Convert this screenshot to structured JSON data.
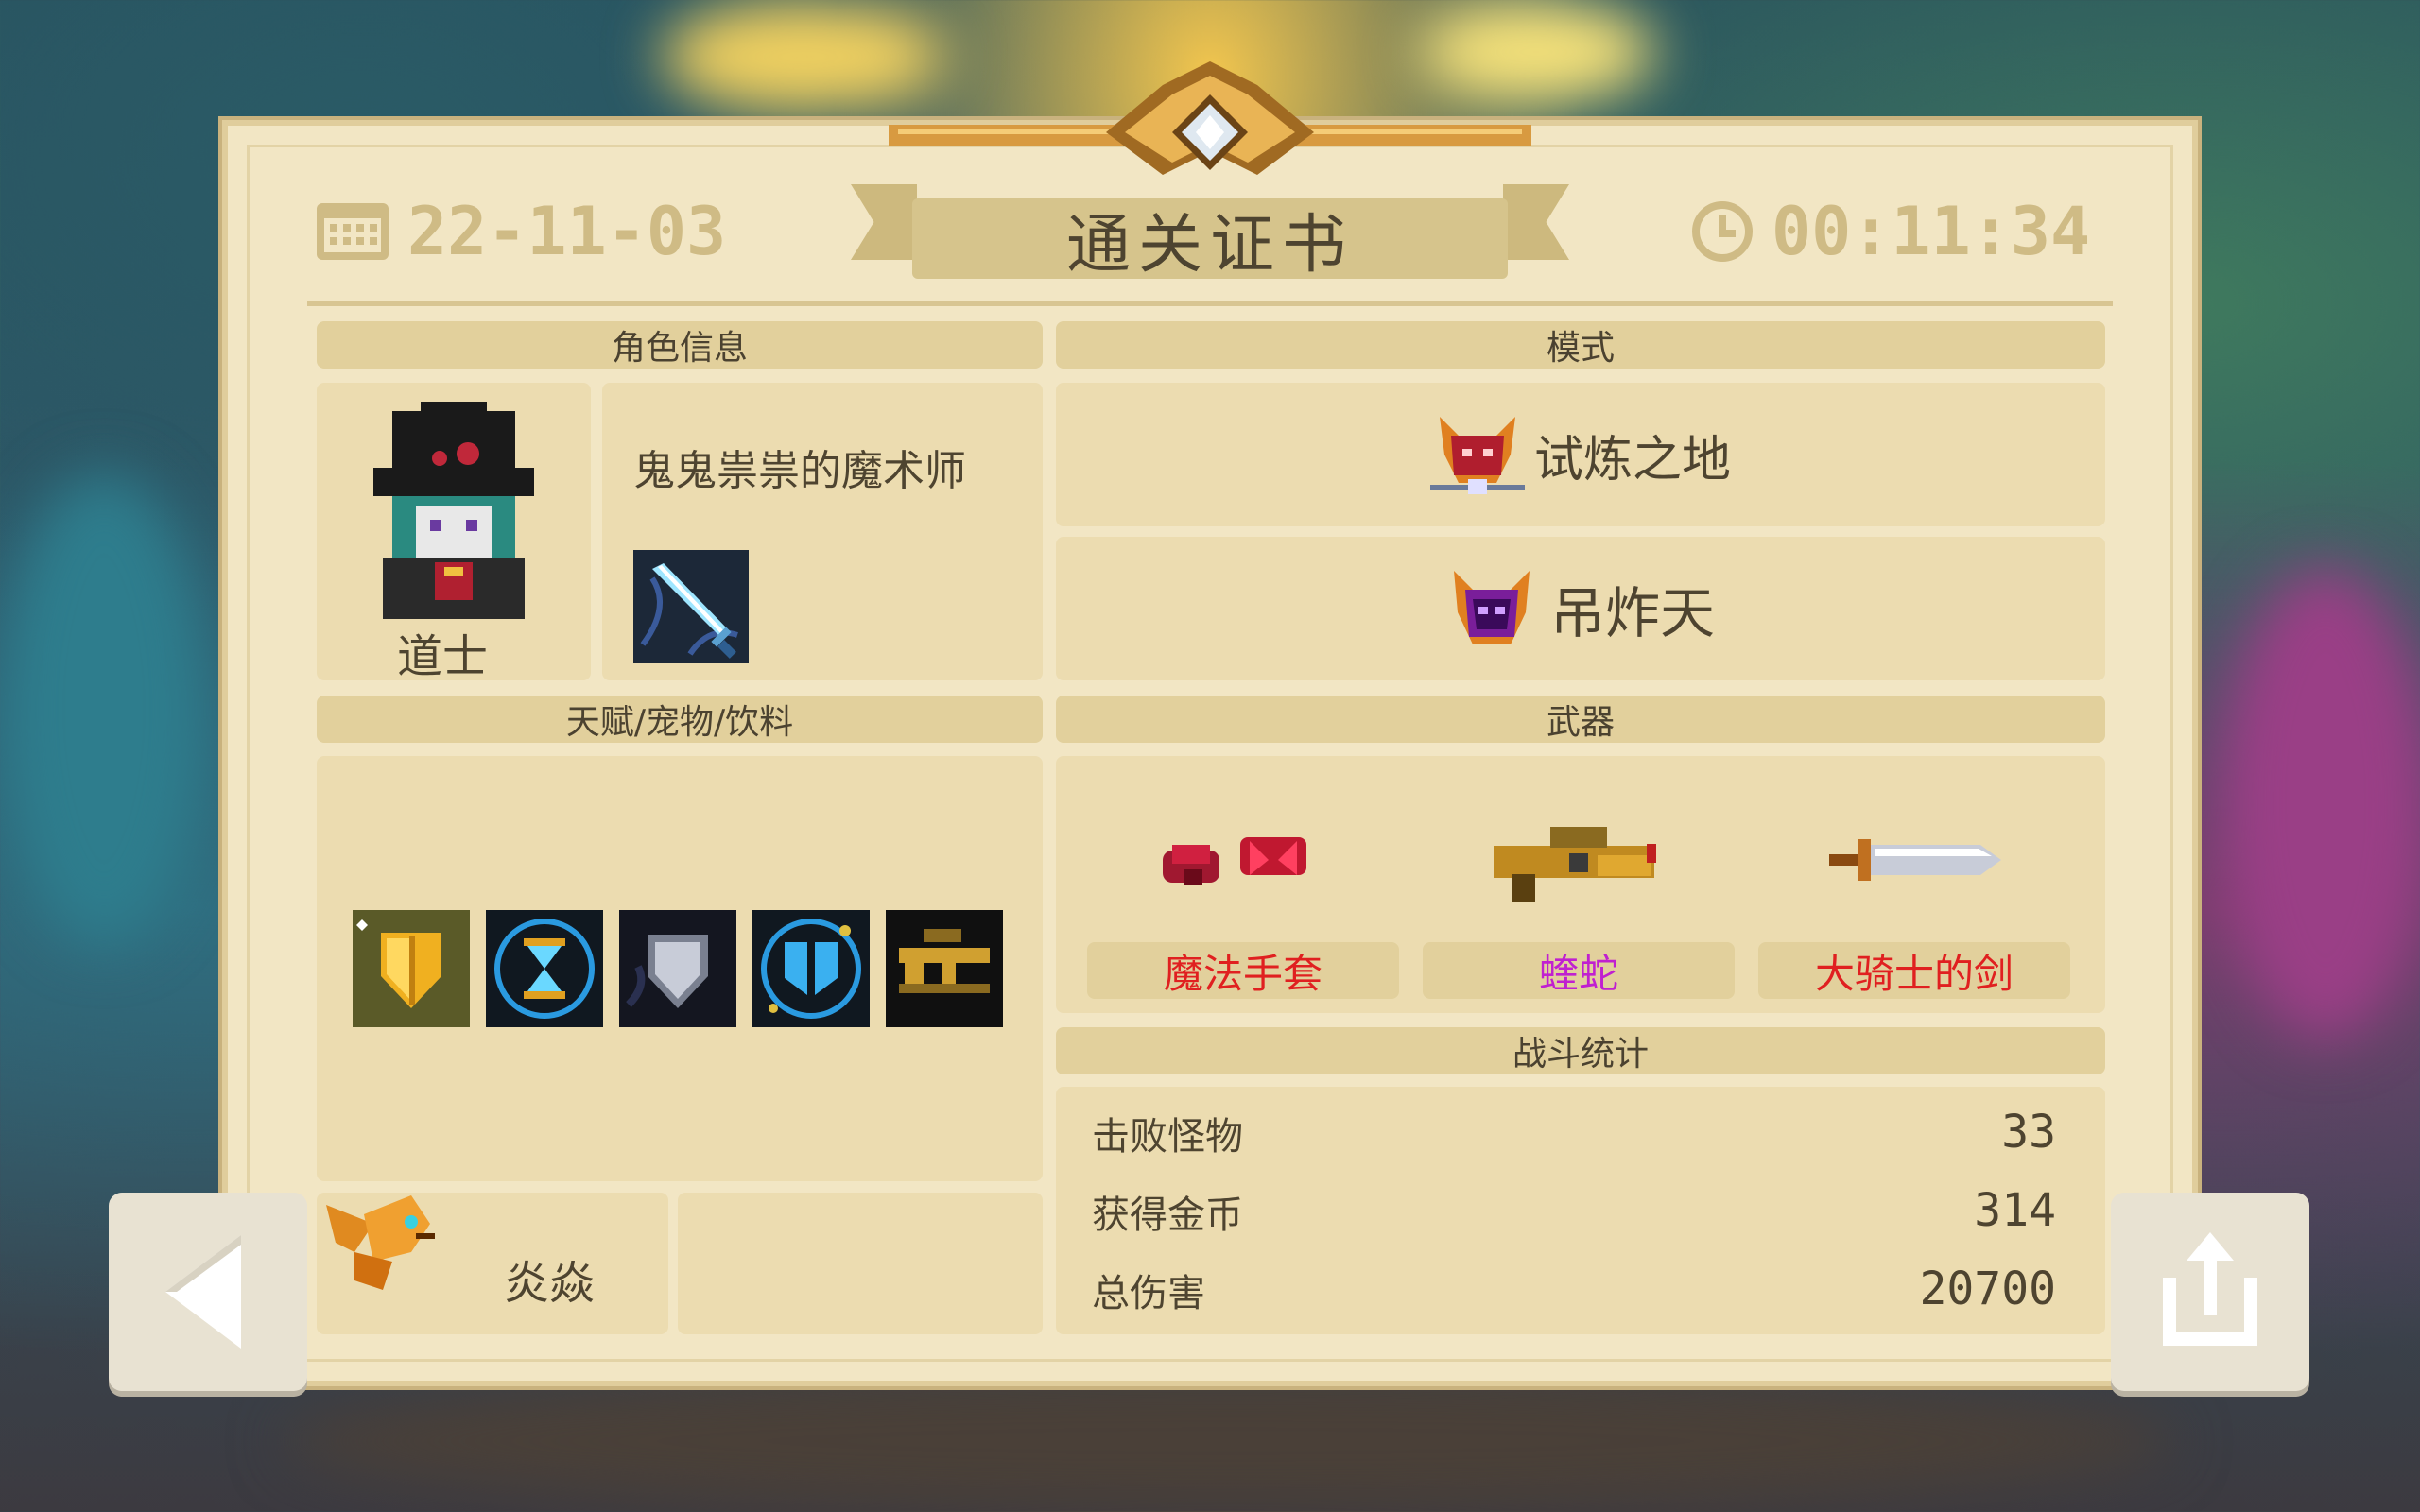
{
  "header": {
    "date": "22-11-03",
    "title": "通关证书",
    "time": "00:11:34"
  },
  "character": {
    "section_label": "角色信息",
    "class_name": "道士",
    "skin_name": "鬼鬼祟祟的魔术师"
  },
  "mode": {
    "section_label": "模式",
    "primary": "试炼之地",
    "secondary": "吊炸天"
  },
  "talents": {
    "section_label": "天赋/宠物/饮料",
    "icons": [
      "golden-shield-icon",
      "hourglass-icon",
      "silver-shield-icon",
      "broken-shield-icon",
      "weapon-upgrade-icon"
    ],
    "pet_name": "炎焱"
  },
  "weapons": {
    "section_label": "武器",
    "items": [
      {
        "name": "魔法手套",
        "color": "#e02020"
      },
      {
        "name": "蝰蛇",
        "color": "#c020d0"
      },
      {
        "name": "大骑士的剑",
        "color": "#e02020"
      }
    ]
  },
  "stats": {
    "section_label": "战斗统计",
    "rows": [
      {
        "label": "击败怪物",
        "value": "33"
      },
      {
        "label": "获得金币",
        "value": "314"
      },
      {
        "label": "总伤害",
        "value": "20700"
      }
    ]
  },
  "nav": {
    "back_icon": "back-arrow-icon",
    "share_icon": "share-icon"
  }
}
